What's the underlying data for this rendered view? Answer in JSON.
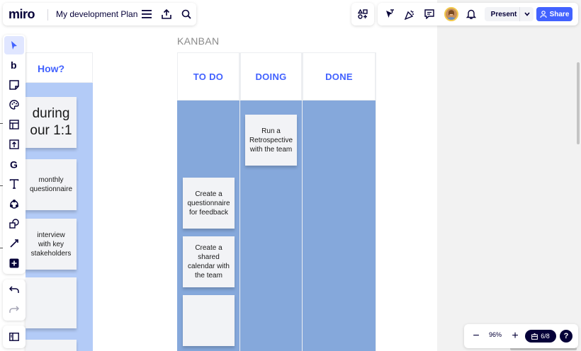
{
  "header": {
    "logo": "miro",
    "board_name": "My development Plan",
    "icons": [
      "menu-icon",
      "export-icon",
      "search-icon"
    ]
  },
  "collab": {
    "icons": [
      "apps-icon",
      "cursor-icon",
      "reactions-icon",
      "comments-icon",
      "avatar",
      "bell-icon"
    ],
    "present_label": "Present",
    "share_label": "Share"
  },
  "toolbar": {
    "tools": [
      "select-icon",
      "bold-b-icon",
      "sticky-note-icon",
      "palette-icon",
      "frame-icon",
      "upload-icon",
      "google-icon",
      "text-icon",
      "diagram-icon",
      "shapes-icon",
      "pen-icon",
      "add-icon"
    ]
  },
  "left_board": {
    "header": "How?",
    "notes": [
      {
        "text": "during our 1:1"
      },
      {
        "text": "monthly questionnaire"
      },
      {
        "text": "interview with key stakeholders"
      },
      {
        "text": ""
      },
      {
        "text": ""
      }
    ]
  },
  "kanban": {
    "title": "KANBAN",
    "columns": [
      {
        "title": "TO DO",
        "notes": [
          "Create a questionnaire for feedback",
          "Create a shared calendar with the team",
          ""
        ]
      },
      {
        "title": "DOING",
        "notes": [
          "Run a Retrospective with the team"
        ]
      },
      {
        "title": "DONE",
        "notes": []
      }
    ]
  },
  "zoom": {
    "minus": "−",
    "level": "96%",
    "plus": "+",
    "frames": "6/8",
    "help": "?"
  },
  "colors": {
    "accent": "#4262ff",
    "kanban_body": "#85a8db",
    "left_column": "#b3cbf7",
    "sticky": "#f2f3f6",
    "ink": "#050038"
  }
}
